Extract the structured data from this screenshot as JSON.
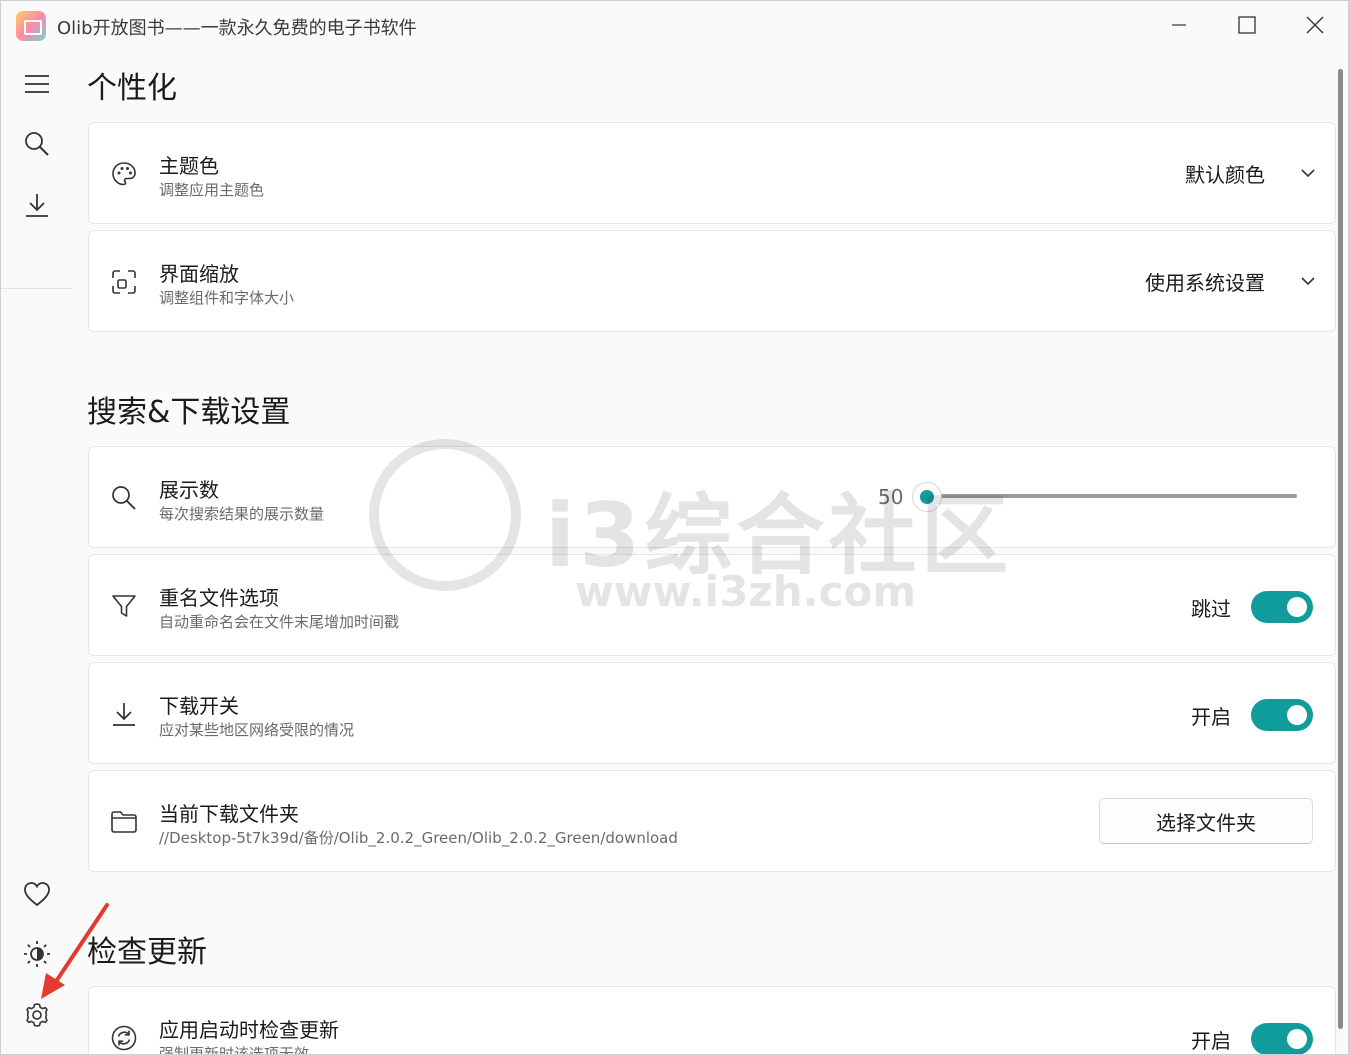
{
  "window": {
    "title": "Olib开放图书——一款永久免费的电子书软件",
    "controls": {
      "minimize": "minimize-icon",
      "maximize": "maximize-icon",
      "close": "close-icon"
    }
  },
  "nav": {
    "top": [
      {
        "icon": "hamburger-menu-icon"
      },
      {
        "icon": "search-icon"
      },
      {
        "icon": "download-icon"
      }
    ],
    "bottom": [
      {
        "icon": "heart-icon"
      },
      {
        "icon": "brightness-icon"
      },
      {
        "icon": "settings-gear-icon"
      }
    ]
  },
  "sections": {
    "personalize": {
      "title": "个性化",
      "theme": {
        "title": "主题色",
        "desc": "调整应用主题色",
        "value": "默认颜色",
        "icon": "palette-icon"
      },
      "scale": {
        "title": "界面缩放",
        "desc": "调整组件和字体大小",
        "value": "使用系统设置",
        "icon": "scale-icon"
      }
    },
    "search_download": {
      "title": "搜索&下载设置",
      "display_count": {
        "title": "展示数",
        "desc": "每次搜索结果的展示数量",
        "value": "50",
        "icon": "search-icon"
      },
      "rename": {
        "title": "重名文件选项",
        "desc": "自动重命名会在文件末尾增加时间戳",
        "toggle_label": "跳过",
        "on": true,
        "icon": "filter-icon"
      },
      "download_switch": {
        "title": "下载开关",
        "desc": "应对某些地区网络受限的情况",
        "toggle_label": "开启",
        "on": true,
        "icon": "download-icon"
      },
      "folder": {
        "title": "当前下载文件夹",
        "desc": "//Desktop-5t7k39d/备份/Olib_2.0.2_Green/Olib_2.0.2_Green/download",
        "button": "选择文件夹",
        "icon": "folder-icon"
      }
    },
    "update": {
      "title": "检查更新",
      "auto_check": {
        "title": "应用启动时检查更新",
        "desc": "强制更新时该选项无效",
        "toggle_label": "开启",
        "on": true,
        "icon": "refresh-icon"
      }
    }
  },
  "watermark": {
    "text": "i3综合社区",
    "url": "www.i3zh.com"
  },
  "colors": {
    "accent": "#109c9c",
    "background": "#fafafa",
    "card": "#ffffff"
  }
}
